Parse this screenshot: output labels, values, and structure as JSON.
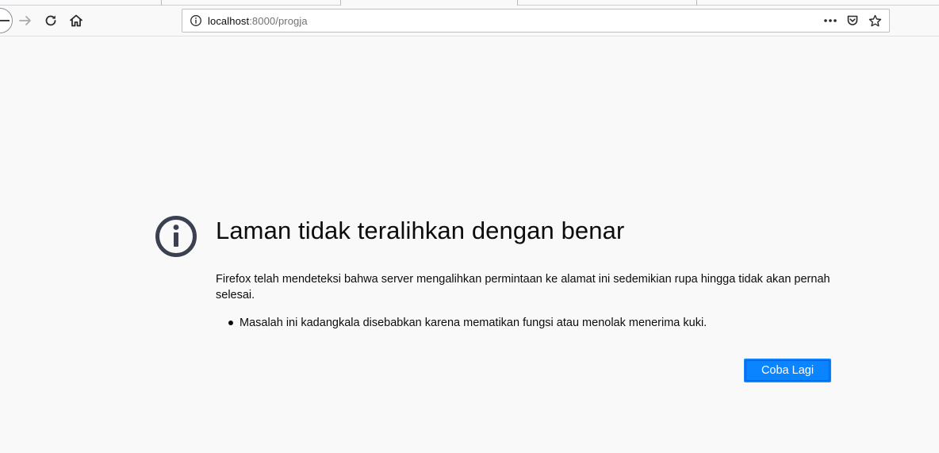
{
  "browser": {
    "url": {
      "host": "localhost",
      "rest": ":8000/progja"
    }
  },
  "icons": {
    "back": "back-arrow-icon",
    "forward": "forward-arrow-icon",
    "reload": "reload-icon",
    "home": "home-icon",
    "site_info": "info-icon",
    "page_actions": "ellipsis-icon",
    "pocket": "pocket-icon",
    "bookmark": "star-icon",
    "error": "info-circle-icon"
  },
  "error_page": {
    "title": "Laman tidak teralihkan dengan benar",
    "description": "Firefox telah mendeteksi bahwa server mengalihkan permintaan ke alamat ini sedemikian rupa hingga tidak akan pernah selesai.",
    "bullets": [
      "Masalah ini kadangkala disebabkan karena mematikan fungsi atau menolak menerima kuki."
    ],
    "retry_label": "Coba Lagi"
  },
  "colors": {
    "accent": "#0a84ff",
    "page_background": "#f9f9fa",
    "icon": "#3b4150"
  }
}
